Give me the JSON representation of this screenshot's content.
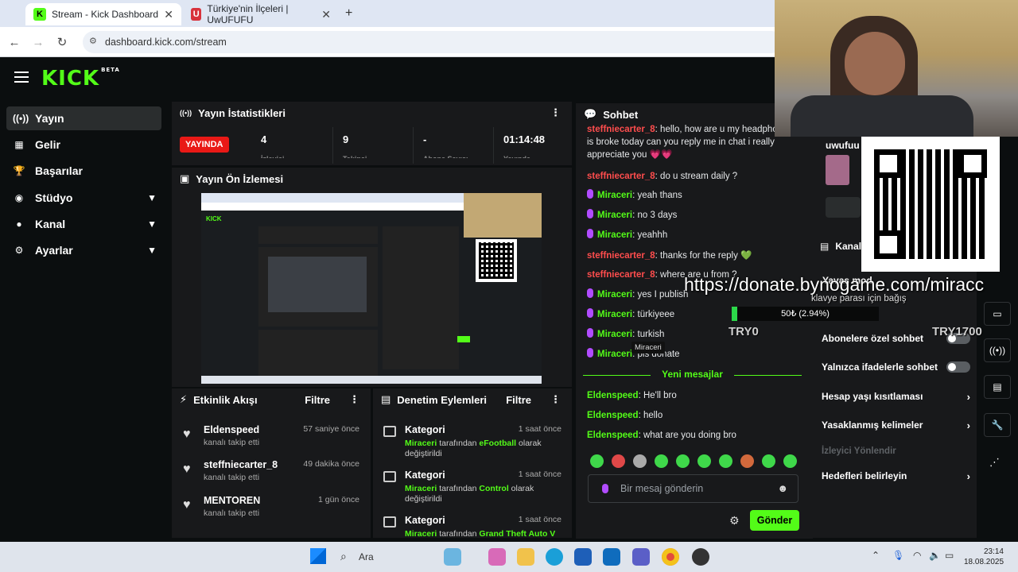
{
  "browser": {
    "tabs": [
      {
        "title": "Stream - Kick Dashboard",
        "active": true,
        "favicon_color": "#53fc18"
      },
      {
        "title": "Türkiye'nin İlçeleri | UwUFUFU",
        "active": false,
        "favicon_color": "#d8323c"
      }
    ],
    "url": "dashboard.kick.com/stream"
  },
  "kick": {
    "logo": "KICK",
    "logo_badge": "BETA"
  },
  "sidebar": {
    "items": [
      {
        "label": "Yayın",
        "icon": "broadcast-icon",
        "active": true,
        "chevron": false
      },
      {
        "label": "Gelir",
        "icon": "chart-icon",
        "active": false,
        "chevron": false
      },
      {
        "label": "Başarılar",
        "icon": "trophy-icon",
        "active": false,
        "chevron": false
      },
      {
        "label": "Stüdyo",
        "icon": "camera-icon",
        "active": false,
        "chevron": true
      },
      {
        "label": "Kanal",
        "icon": "user-icon",
        "active": false,
        "chevron": true
      },
      {
        "label": "Ayarlar",
        "icon": "gear-icon",
        "active": false,
        "chevron": true
      }
    ]
  },
  "stats": {
    "title": "Yayın İstatistikleri",
    "live_badge": "YAYINDA",
    "viewers": "4",
    "viewers_label": "İzleyici",
    "followers": "9",
    "followers_label": "Takipçi",
    "subs": "-",
    "subs_label": "Abone Sayısı",
    "duration": "01:14:48",
    "duration_label": "Yayında"
  },
  "preview": {
    "title": "Yayın Ön İzlemesi"
  },
  "activity": {
    "title": "Etkinlik Akışı",
    "filter": "Filtre",
    "items": [
      {
        "name": "Eldenspeed",
        "sub": "kanalı takip etti",
        "time": "57 saniye önce"
      },
      {
        "name": "steffniecarter_8",
        "sub": "kanalı takip etti",
        "time": "49 dakika önce"
      },
      {
        "name": "MENTOREN",
        "sub": "kanalı takip etti",
        "time": "1 gün önce"
      }
    ]
  },
  "moderation": {
    "title": "Denetim Eylemleri",
    "filter": "Filtre",
    "items": [
      {
        "name": "Kategori",
        "time": "1 saat önce",
        "user": "Miraceri",
        "mid": "tarafından",
        "game": "eFootball",
        "end": "olarak değiştirildi"
      },
      {
        "name": "Kategori",
        "time": "1 saat önce",
        "user": "Miraceri",
        "mid": "tarafından",
        "game": "Control",
        "end": "olarak değiştirildi"
      },
      {
        "name": "Kategori",
        "time": "1 saat önce",
        "user": "Miraceri",
        "mid": "tarafından",
        "game": "Grand Theft Auto V",
        "end": ""
      }
    ]
  },
  "chat": {
    "title": "Sohbet",
    "messages": [
      {
        "user": "steffniecarter_8",
        "color": "red",
        "text": "hello, how are u my headphone is broke today can you reply me in chat i really appreciate you 💗💗",
        "mic": false
      },
      {
        "user": "steffniecarter_8",
        "color": "red",
        "text": "do u stream daily ?",
        "mic": false
      },
      {
        "user": "Miraceri",
        "color": "green",
        "text": "yeah thans",
        "mic": true
      },
      {
        "user": "Miraceri",
        "color": "green",
        "text": "no 3 days",
        "mic": true
      },
      {
        "user": "Miraceri",
        "color": "green",
        "text": "yeahhh",
        "mic": true
      },
      {
        "user": "steffniecarter_8",
        "color": "red",
        "text": "thanks for the reply 💚",
        "mic": false
      },
      {
        "user": "steffniecarter_8",
        "color": "red",
        "text": "where are u from ?",
        "mic": false
      },
      {
        "user": "Miraceri",
        "color": "green",
        "text": "yes I publish",
        "mic": true
      },
      {
        "user": "Miraceri",
        "color": "green",
        "text": "türkiyeee",
        "mic": true
      },
      {
        "user": "Miraceri",
        "color": "green",
        "text": "turkish",
        "mic": true
      },
      {
        "user": "Miraceri",
        "color": "green",
        "text": "pls donate",
        "mic": true
      }
    ],
    "tooltip": "Miraceri",
    "new_messages": "Yeni mesajlar",
    "new": [
      {
        "user": "Eldenspeed",
        "text": "He'll bro"
      },
      {
        "user": "Eldenspeed",
        "text": "hello"
      },
      {
        "user": "Eldenspeed",
        "text": "what are you doing bro"
      }
    ],
    "input_placeholder": "Bir mesaj gönderin",
    "send": "Gönder"
  },
  "modpanel": {
    "channel_header": "Kanal",
    "partial_user": "uwufuu",
    "slow_mode": "Yavaş mod",
    "rows": [
      {
        "label": "Abonelere özel sohbet",
        "type": "toggle"
      },
      {
        "label": "Yalnızca ifadelerle sohbet",
        "type": "toggle"
      },
      {
        "label": "Hesap yaşı kısıtlaması",
        "type": "chevron"
      },
      {
        "label": "Yasaklanmış kelimeler",
        "type": "chevron"
      }
    ],
    "redirect_label": "İzleyici Yönlendir",
    "goals": "Hedefleri belirleyin"
  },
  "overlay": {
    "donate_url": "https://donate.bynogame.com/miracc",
    "goal_text": "klavye parası için bağış",
    "goal_progress": "50₺ (2.94%)",
    "goal_fraction": 0.0294,
    "try_left": "TRY0",
    "try_right": "TRY1700"
  },
  "taskbar": {
    "search": "Ara",
    "time": "23:14",
    "date": "18.08.2025"
  }
}
